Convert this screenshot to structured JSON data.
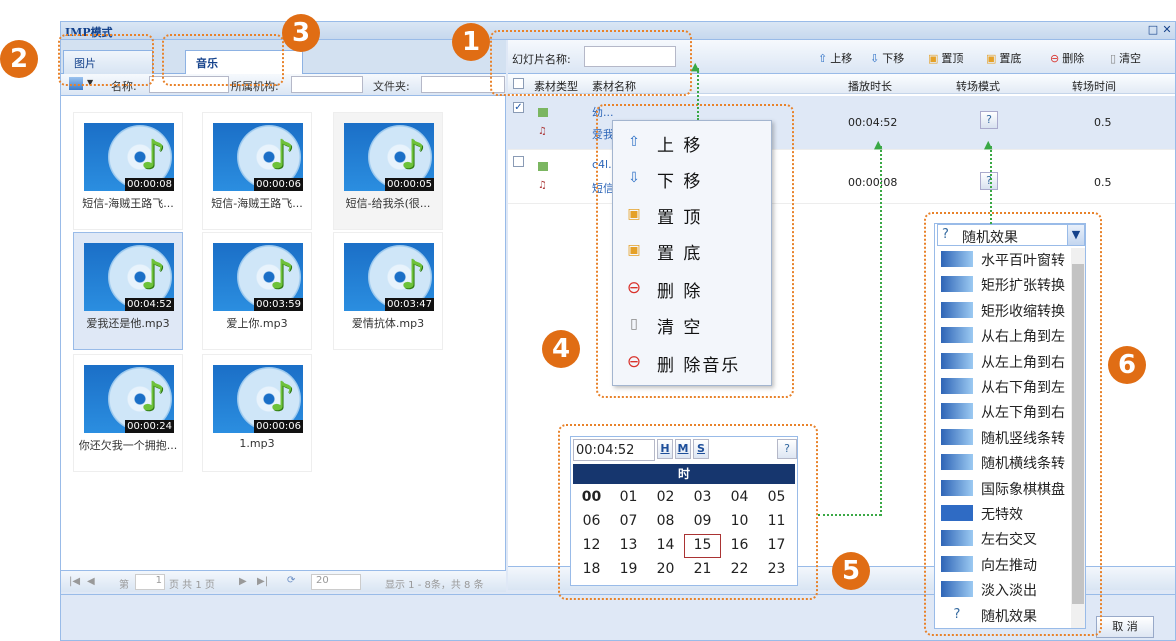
{
  "window": {
    "title": "IMP模式",
    "btn_restore": "□",
    "btn_close": "✕"
  },
  "left": {
    "tabs": [
      {
        "label": "图片"
      },
      {
        "label": "音乐"
      }
    ],
    "filter": {
      "name_label": "名称:",
      "org_label": "所属机构:",
      "folder_label": "文件夹:"
    },
    "items": [
      {
        "caption": "短信-海贼王路飞...",
        "duration": "00:00:08"
      },
      {
        "caption": "短信-海贼王路飞...",
        "duration": "00:00:06"
      },
      {
        "caption": "短信-给我杀(很...",
        "duration": "00:00:05"
      },
      {
        "caption": "爱我还是他.mp3",
        "duration": "00:04:52"
      },
      {
        "caption": "爱上你.mp3",
        "duration": "00:03:59"
      },
      {
        "caption": "爱情抗体.mp3",
        "duration": "00:03:47"
      },
      {
        "caption": "你还欠我一个拥抱...",
        "duration": "00:00:24"
      },
      {
        "caption": "1.mp3",
        "duration": "00:00:06"
      }
    ],
    "pager": {
      "page_label": "第",
      "page": "1",
      "of": "页 共 1 页",
      "size": "20",
      "summary": "显示 1 - 8条，共 8 条"
    }
  },
  "right": {
    "slide_name_label": "幻灯片名称:",
    "toolbar": {
      "up": "上移",
      "down": "下移",
      "top": "置顶",
      "bottom": "置底",
      "delete": "删除",
      "clear": "清空"
    },
    "headers": {
      "type": "素材类型",
      "name": "素材名称",
      "duration": "播放时长",
      "mode": "转场模式",
      "time": "转场时间"
    },
    "rows": [
      {
        "name1": "幼...",
        "name2": "爱我...",
        "duration": "00:04:52",
        "time": "0.5",
        "checked": "✓"
      },
      {
        "name1": "c4l...3b16f.jpg",
        "name2": "短信...",
        "duration": "00:00:08",
        "time": "0.5",
        "checked": ""
      }
    ]
  },
  "context_menu": [
    {
      "label": "上 移",
      "icon": "arrow-up-icon"
    },
    {
      "label": "下 移",
      "icon": "arrow-down-icon"
    },
    {
      "label": "置 顶",
      "icon": "bring-top-icon"
    },
    {
      "label": "置 底",
      "icon": "send-bottom-icon"
    },
    {
      "label": "删 除",
      "icon": "delete-icon"
    },
    {
      "label": "清 空",
      "icon": "trash-icon"
    },
    {
      "label": "删 除音乐",
      "icon": "delete-music-icon"
    }
  ],
  "picker": {
    "time": "00:04:52",
    "h": "H",
    "m": "M",
    "s": "S",
    "header": "时",
    "help": "?",
    "hours": [
      "00",
      "01",
      "02",
      "03",
      "04",
      "05",
      "06",
      "07",
      "08",
      "09",
      "10",
      "11",
      "12",
      "13",
      "14",
      "15",
      "16",
      "17",
      "18",
      "19",
      "20",
      "21",
      "22",
      "23"
    ]
  },
  "effects": {
    "selected": "随机效果",
    "options": [
      "水平百叶窗转",
      "矩形扩张转换",
      "矩形收缩转换",
      "从右上角到左",
      "从左上角到右",
      "从右下角到左",
      "从左下角到右",
      "随机竖线条转",
      "随机横线条转",
      "国际象棋棋盘",
      "无特效",
      "左右交叉",
      "向左推动",
      "淡入淡出",
      "随机效果"
    ]
  },
  "cancel": "取 消",
  "badges": [
    "1",
    "2",
    "3",
    "4",
    "5",
    "6"
  ]
}
